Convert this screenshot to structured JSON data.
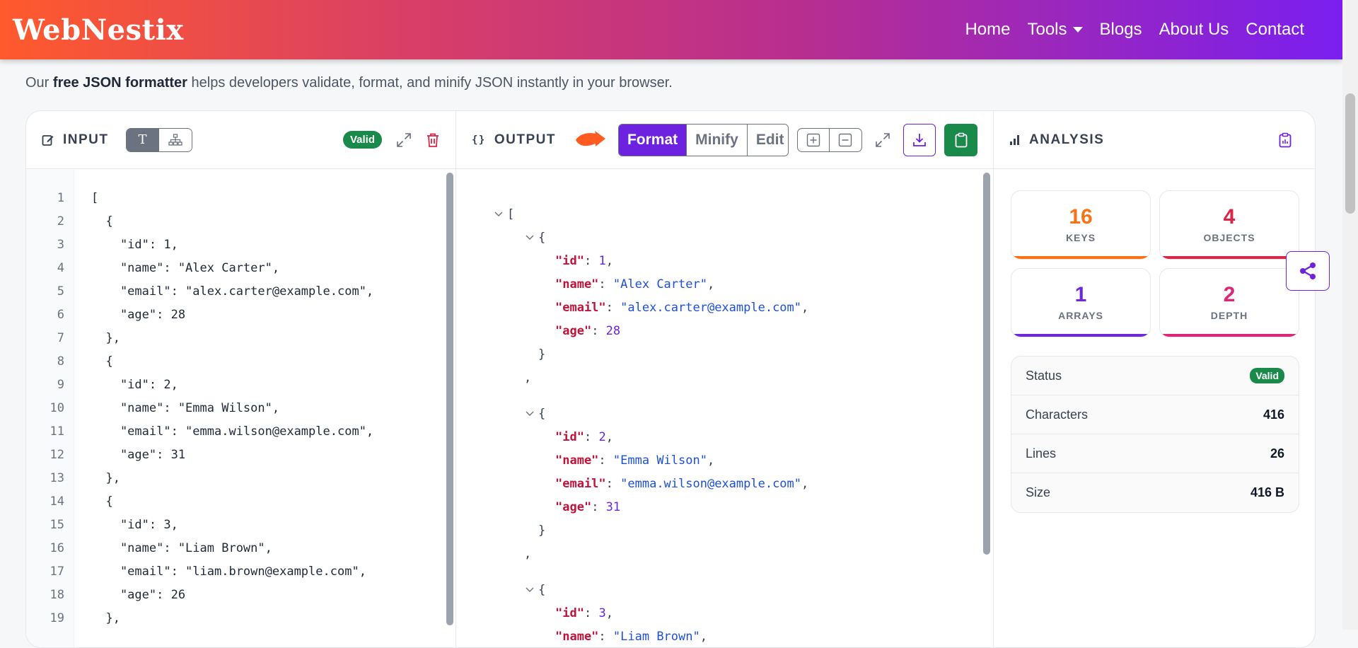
{
  "navbar": {
    "logo": "WebNestix",
    "items": [
      {
        "label": "Home"
      },
      {
        "label": "Tools"
      },
      {
        "label": "Blogs"
      },
      {
        "label": "About Us"
      },
      {
        "label": "Contact"
      }
    ]
  },
  "intro": {
    "prefix": "Our ",
    "bold": "free JSON formatter",
    "suffix": " helps developers validate, format, and minify JSON instantly in your browser."
  },
  "input_panel": {
    "title": "INPUT",
    "toggle_text_label": "T",
    "valid_badge": "Valid",
    "lines": [
      "[",
      "  {",
      "    \"id\": 1,",
      "    \"name\": \"Alex Carter\",",
      "    \"email\": \"alex.carter@example.com\",",
      "    \"age\": 28",
      "  },",
      "  {",
      "    \"id\": 2,",
      "    \"name\": \"Emma Wilson\",",
      "    \"email\": \"emma.wilson@example.com\",",
      "    \"age\": 31",
      "  },",
      "  {",
      "    \"id\": 3,",
      "    \"name\": \"Liam Brown\",",
      "    \"email\": \"liam.brown@example.com\",",
      "    \"age\": 26",
      "  },"
    ],
    "line_numbers": [
      "1",
      "2",
      "3",
      "4",
      "5",
      "6",
      "7",
      "8",
      "9",
      "10",
      "11",
      "12",
      "13",
      "14",
      "15",
      "16",
      "17",
      "18",
      "19"
    ]
  },
  "output_panel": {
    "title": "OUTPUT",
    "buttons": {
      "format": "Format",
      "minify": "Minify",
      "edit": "Edit"
    },
    "tree": {
      "open_bracket": "[",
      "open_brace": "{",
      "close_brace": "}",
      "comma": ",",
      "objects": [
        {
          "id": "1",
          "name": "\"Alex Carter\"",
          "email": "\"alex.carter@example.com\"",
          "age": "28"
        },
        {
          "id": "2",
          "name": "\"Emma Wilson\"",
          "email": "\"emma.wilson@example.com\"",
          "age": "31"
        },
        {
          "id": "3",
          "name": "\"Liam Brown\""
        }
      ],
      "keys": {
        "id": "\"id\"",
        "name": "\"name\"",
        "email": "\"email\"",
        "age": "\"age\""
      }
    }
  },
  "analysis_panel": {
    "title": "ANALYSIS",
    "stats": [
      {
        "value": "16",
        "label": "KEYS",
        "color": "#f97316"
      },
      {
        "value": "4",
        "label": "OBJECTS",
        "color": "#dc2645"
      },
      {
        "value": "1",
        "label": "ARRAYS",
        "color": "#6d28d9"
      },
      {
        "value": "2",
        "label": "DEPTH",
        "color": "#db2777"
      }
    ],
    "info": [
      {
        "label": "Status",
        "value": "Valid"
      },
      {
        "label": "Characters",
        "value": "416"
      },
      {
        "label": "Lines",
        "value": "26"
      },
      {
        "label": "Size",
        "value": "416 B"
      }
    ]
  },
  "colors": {
    "accent_purple": "#6d22e0",
    "valid_green": "#1a8a4a",
    "key_red": "#c1123a",
    "string_blue": "#1d4fd8",
    "arrow_orange": "#ff5a1f"
  },
  "icons": [
    "edit-icon",
    "tree-icon",
    "expand-icon",
    "trash-icon",
    "braces-icon",
    "plus-box-icon",
    "minus-box-icon",
    "download-icon",
    "clipboard-icon",
    "bar-chart-icon",
    "share-icon",
    "pointer-arrow-icon"
  ]
}
